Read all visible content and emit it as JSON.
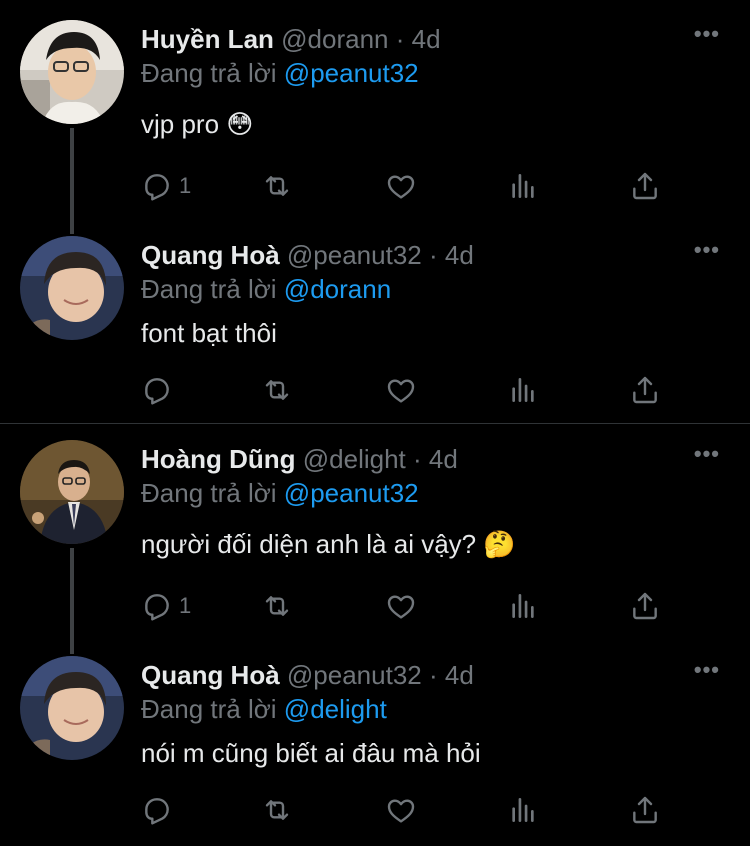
{
  "colors": {
    "background": "#000000",
    "text": "#e7e9ea",
    "muted": "#71767b",
    "mention": "#1d9bf0",
    "divider": "#2f3336",
    "thread_line": "#3e4144"
  },
  "reply_prefix": "Đang trả lời",
  "tweets": [
    {
      "name": "Huyền Lan",
      "handle": "@dorann",
      "time": "4d",
      "replying_to": "@peanut32",
      "text": "vjp pro 😳",
      "reply_count": "1",
      "avatar_icon": "avatar-photo"
    },
    {
      "name": "Quang Hoà",
      "handle": "@peanut32",
      "time": "4d",
      "replying_to": "@dorann",
      "text": "font bạt thôi",
      "reply_count": "",
      "avatar_icon": "avatar-photo"
    },
    {
      "name": "Hoàng Dũng",
      "handle": "@delight",
      "time": "4d",
      "replying_to": "@peanut32",
      "text": "người đối diện anh là ai vậy? 🤔",
      "reply_count": "1",
      "avatar_icon": "avatar-photo"
    },
    {
      "name": "Quang Hoà",
      "handle": "@peanut32",
      "time": "4d",
      "replying_to": "@delight",
      "text": "nói m cũng biết ai đâu mà hỏi",
      "reply_count": "",
      "avatar_icon": "avatar-photo"
    }
  ],
  "more_label": "•••",
  "separator": "·",
  "action_icons": [
    "reply-icon",
    "retweet-icon",
    "like-icon",
    "analytics-icon",
    "share-icon"
  ]
}
